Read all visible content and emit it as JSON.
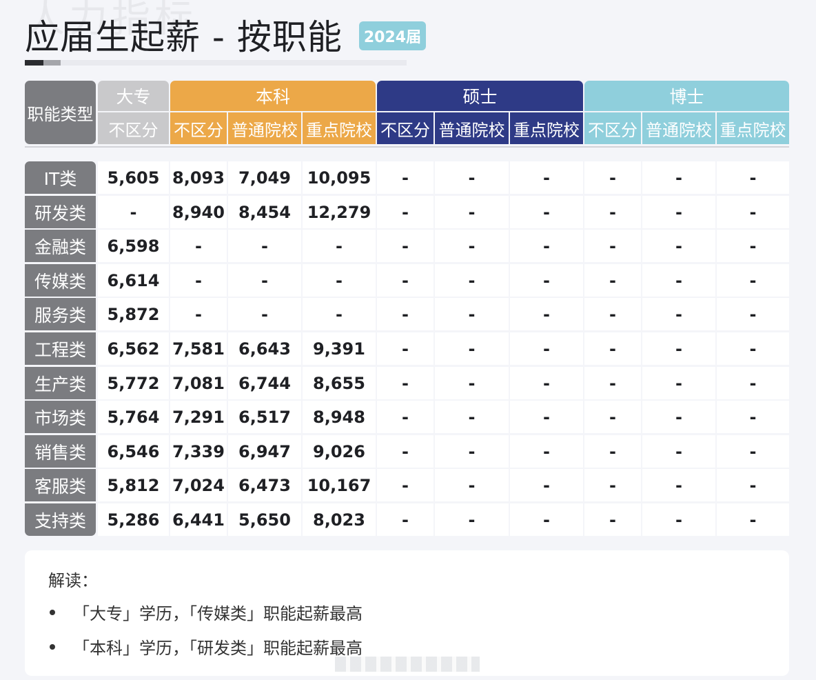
{
  "header": {
    "watermark": "人力指标",
    "title": "应届生起薪 - 按职能",
    "year_badge": "2024届"
  },
  "colors": {
    "label_gray": "#7b7c80",
    "dazhuan": "#c9c9cb",
    "benke": "#eca848",
    "shuoshi": "#2e3a86",
    "boshi": "#8fcfdc",
    "badge": "#8fcfdc"
  },
  "table": {
    "corner_label": "职能类型",
    "groups": [
      {
        "label": "大专",
        "subs": [
          "不区分"
        ]
      },
      {
        "label": "本科",
        "subs": [
          "不区分",
          "普通院校",
          "重点院校"
        ]
      },
      {
        "label": "硕士",
        "subs": [
          "不区分",
          "普通院校",
          "重点院校"
        ]
      },
      {
        "label": "博士",
        "subs": [
          "不区分",
          "普通院校",
          "重点院校"
        ]
      }
    ],
    "rows": [
      {
        "label": "IT类",
        "values": [
          "5,605",
          "8,093",
          "7,049",
          "10,095",
          "-",
          "-",
          "-",
          "-",
          "-",
          "-"
        ]
      },
      {
        "label": "研发类",
        "values": [
          "-",
          "8,940",
          "8,454",
          "12,279",
          "-",
          "-",
          "-",
          "-",
          "-",
          "-"
        ]
      },
      {
        "label": "金融类",
        "values": [
          "6,598",
          "-",
          "-",
          "-",
          "-",
          "-",
          "-",
          "-",
          "-",
          "-"
        ]
      },
      {
        "label": "传媒类",
        "values": [
          "6,614",
          "-",
          "-",
          "-",
          "-",
          "-",
          "-",
          "-",
          "-",
          "-"
        ]
      },
      {
        "label": "服务类",
        "values": [
          "5,872",
          "-",
          "-",
          "-",
          "-",
          "-",
          "-",
          "-",
          "-",
          "-"
        ]
      },
      {
        "label": "工程类",
        "values": [
          "6,562",
          "7,581",
          "6,643",
          "9,391",
          "-",
          "-",
          "-",
          "-",
          "-",
          "-"
        ]
      },
      {
        "label": "生产类",
        "values": [
          "5,772",
          "7,081",
          "6,744",
          "8,655",
          "-",
          "-",
          "-",
          "-",
          "-",
          "-"
        ]
      },
      {
        "label": "市场类",
        "values": [
          "5,764",
          "7,291",
          "6,517",
          "8,948",
          "-",
          "-",
          "-",
          "-",
          "-",
          "-"
        ]
      },
      {
        "label": "销售类",
        "values": [
          "6,546",
          "7,339",
          "6,947",
          "9,026",
          "-",
          "-",
          "-",
          "-",
          "-",
          "-"
        ]
      },
      {
        "label": "客服类",
        "values": [
          "5,812",
          "7,024",
          "6,473",
          "10,167",
          "-",
          "-",
          "-",
          "-",
          "-",
          "-"
        ]
      },
      {
        "label": "支持类",
        "values": [
          "5,286",
          "6,441",
          "5,650",
          "8,023",
          "-",
          "-",
          "-",
          "-",
          "-",
          "-"
        ]
      }
    ]
  },
  "note": {
    "title": "解读：",
    "items": [
      "「大专」学历，「传媒类」职能起薪最高",
      "「本科」学历，「研发类」职能起薪最高"
    ]
  }
}
